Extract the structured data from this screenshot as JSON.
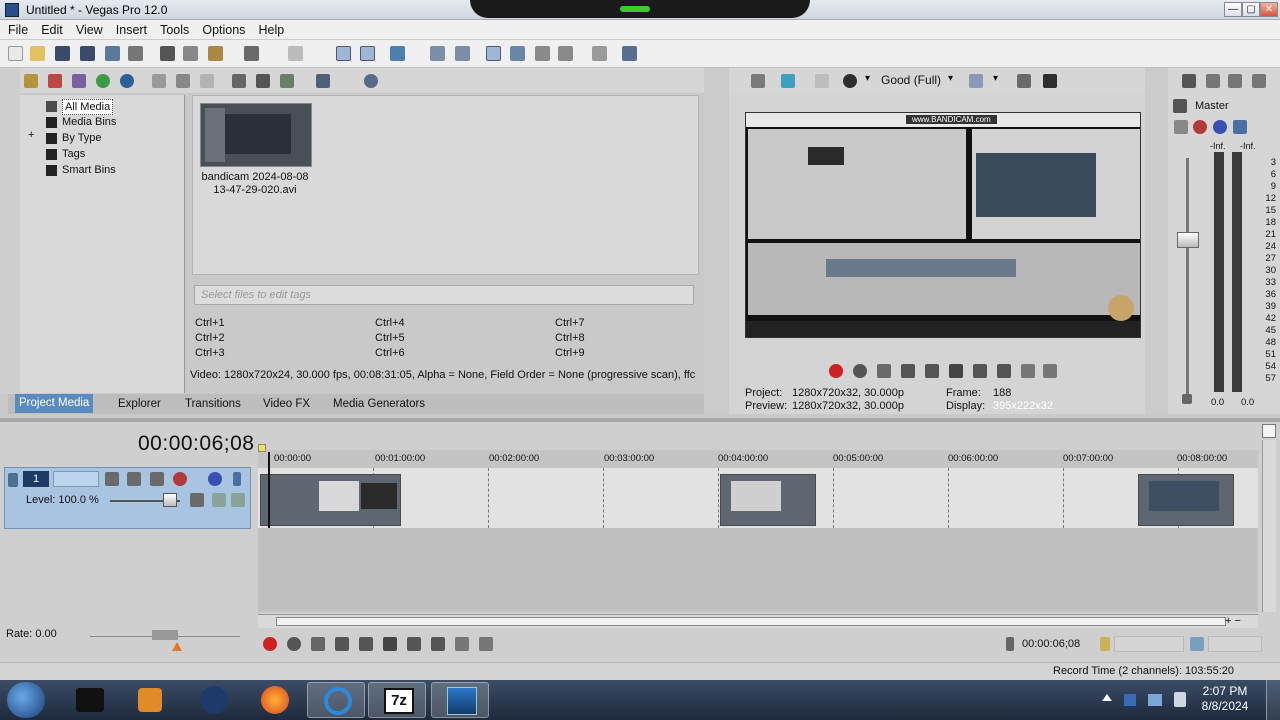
{
  "window": {
    "title": "Untitled * - Vegas Pro 12.0",
    "minimize": "—",
    "maximize": "▢",
    "close": "✕"
  },
  "menu": [
    "File",
    "Edit",
    "View",
    "Insert",
    "Tools",
    "Options",
    "Help"
  ],
  "media": {
    "tree": [
      "All Media",
      "Media Bins",
      "By Type",
      "Tags",
      "Smart Bins"
    ],
    "tree_expand": "+",
    "thumbnail_caption_line1": "bandicam 2024-08-08",
    "thumbnail_caption_line2": "13-47-29-020.avi",
    "tag_placeholder": "Select files to edit tags",
    "shortcuts": [
      "Ctrl+1",
      "Ctrl+2",
      "Ctrl+3",
      "Ctrl+4",
      "Ctrl+5",
      "Ctrl+6",
      "Ctrl+7",
      "Ctrl+8",
      "Ctrl+9"
    ],
    "info": "Video: 1280x720x24, 30.000 fps, 00:08:31:05, Alpha = None, Field Order = None (progressive scan), ffc"
  },
  "tabs": [
    "Project Media",
    "Explorer",
    "Transitions",
    "Video FX",
    "Media Generators"
  ],
  "preview": {
    "quality": "Good (Full)",
    "quality_arrow": "▾",
    "project_label": "Project:",
    "project_value": "1280x720x32, 30.000p",
    "preview_label": "Preview:",
    "preview_value": "1280x720x32, 30.000p",
    "frame_label": "Frame:",
    "frame_value": "188",
    "display_label": "Display:",
    "display_value": "395x222x32",
    "screen_caption": "www.BANDICAM.com"
  },
  "master": {
    "label": "Master",
    "inf_left": "-Inf.",
    "inf_right": "-Inf.",
    "db_scale": [
      "3",
      "6",
      "9",
      "12",
      "15",
      "18",
      "21",
      "24",
      "27",
      "30",
      "33",
      "36",
      "39",
      "42",
      "45",
      "48",
      "51",
      "54",
      "57"
    ],
    "bottom_left": "0.0",
    "bottom_right": "0.0"
  },
  "timeline": {
    "time": "00:00:06;08",
    "ruler": [
      "00:00:00",
      "00:01:00:00",
      "00:02:00:00",
      "00:03:00:00",
      "00:04:00:00",
      "00:05:00:00",
      "00:06:00:00",
      "00:07:00:00",
      "00:08:00:00"
    ],
    "track_number": "1",
    "level": "Level: 100.0 %",
    "rate": "Rate: 0.00",
    "cursor_time": "00:00:06;08"
  },
  "status": {
    "record_time": "Record Time (2 channels): 103:55:20"
  },
  "taskbar": {
    "time": "2:07 PM",
    "date": "8/8/2024",
    "seven_zip": "7z"
  },
  "colors": {
    "accent": "#5a8bbf",
    "track_header": "#a9c4e0",
    "record_red": "#cc2222",
    "taskbar": "#2a3a52"
  }
}
